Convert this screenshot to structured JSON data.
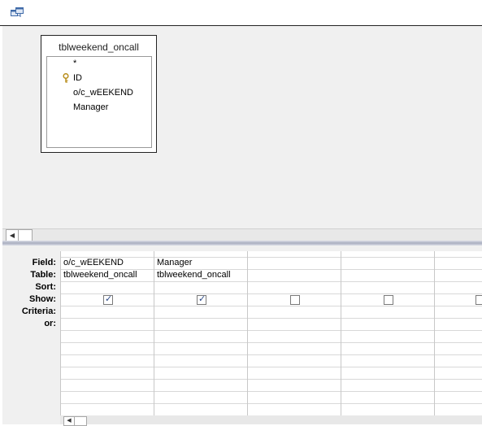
{
  "titlebar": {
    "icon": "query-design-icon"
  },
  "table_window": {
    "caption": "tblweekend_oncall",
    "fields": [
      "*",
      "ID",
      "o/c_wEEKEND",
      "Manager"
    ],
    "primary_key_icon": "key-icon"
  },
  "grid": {
    "row_labels": [
      "Field:",
      "Table:",
      "Sort:",
      "Show:",
      "Criteria:",
      "or:"
    ],
    "columns": [
      {
        "field": "o/c_wEEKEND",
        "table": "tblweekend_oncall",
        "show": true
      },
      {
        "field": "Manager",
        "table": "tblweekend_oncall",
        "show": true
      },
      {
        "field": "",
        "table": "",
        "show": false
      },
      {
        "field": "",
        "table": "",
        "show": false
      },
      {
        "field": "",
        "table": "",
        "show": false
      }
    ]
  },
  "scroll": {
    "left_arrow": "◀"
  }
}
